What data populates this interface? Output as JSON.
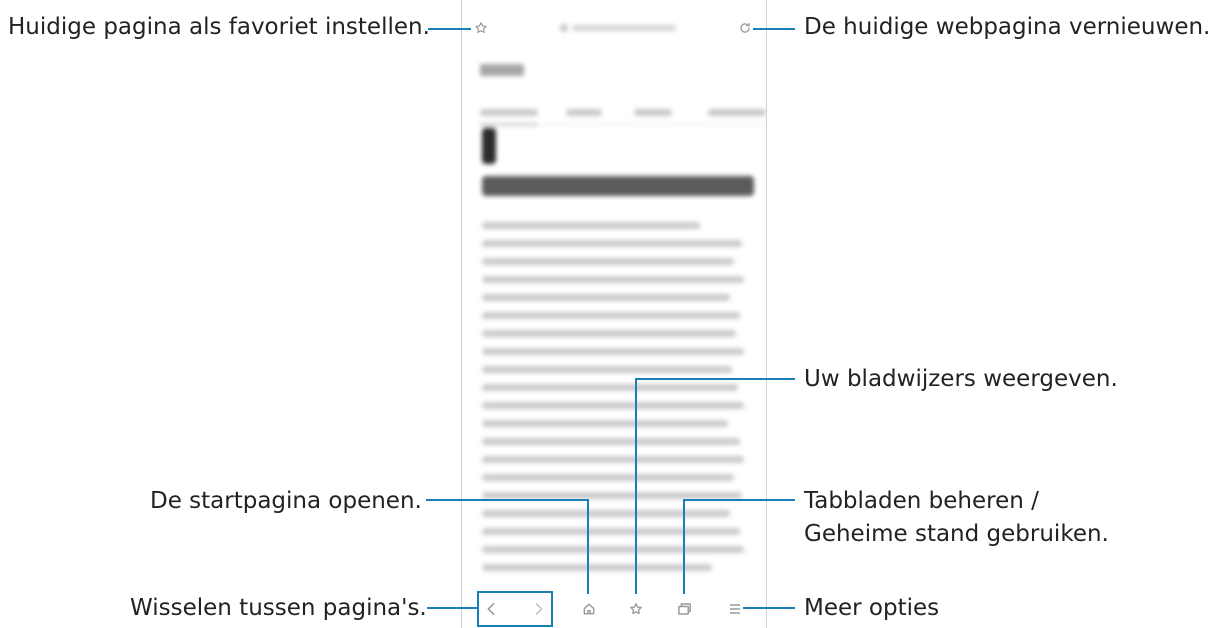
{
  "callouts": {
    "favorite": "Huidige pagina als favoriet instellen.",
    "refresh": "De huidige webpagina vernieuwen.",
    "bookmarks": "Uw bladwijzers weergeven.",
    "home": "De startpagina openen.",
    "tabs_line1": "Tabbladen beheren /",
    "tabs_line2": "Geheime stand gebruiken.",
    "navigate": "Wisselen tussen pagina's.",
    "more": "Meer opties"
  },
  "browser": {
    "icons": {
      "favorite": "star-outline-icon",
      "refresh": "refresh-icon",
      "back": "chevron-left-icon",
      "forward": "chevron-right-icon",
      "home": "home-icon",
      "bookmarks": "star-outline-icon",
      "tabs": "tabs-icon",
      "menu": "hamburger-menu-icon"
    }
  },
  "colors": {
    "callout": "#1a7fb8",
    "icon": "#9a9a9a"
  }
}
